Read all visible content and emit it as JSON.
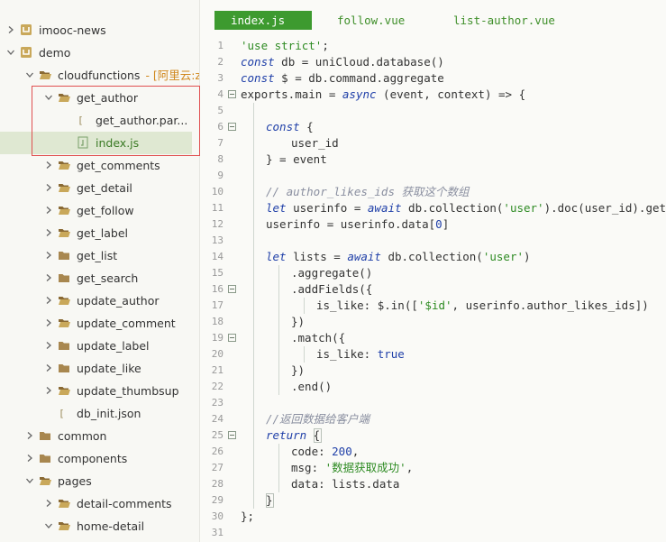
{
  "sidebar": {
    "items": [
      {
        "label": "imooc-news",
        "icon": "project-icon",
        "depth": 0,
        "arrow": "right"
      },
      {
        "label": "demo",
        "icon": "project-icon",
        "depth": 0,
        "arrow": "down"
      },
      {
        "label": "cloudfunctions",
        "suffix": "- [阿里云:zl",
        "icon": "folder-open-icon",
        "depth": 1,
        "arrow": "down"
      },
      {
        "label": "get_author",
        "icon": "folder-open-icon",
        "depth": 2,
        "arrow": "down"
      },
      {
        "label": "get_author.par...",
        "icon": "json-file-icon",
        "depth": 3,
        "arrow": "none"
      },
      {
        "label": "index.js",
        "icon": "js-file-icon",
        "depth": 3,
        "arrow": "none",
        "selected": true
      },
      {
        "label": "get_comments",
        "icon": "folder-open-icon",
        "depth": 2,
        "arrow": "right"
      },
      {
        "label": "get_detail",
        "icon": "folder-open-icon",
        "depth": 2,
        "arrow": "right"
      },
      {
        "label": "get_follow",
        "icon": "folder-open-icon",
        "depth": 2,
        "arrow": "right"
      },
      {
        "label": "get_label",
        "icon": "folder-open-icon",
        "depth": 2,
        "arrow": "right"
      },
      {
        "label": "get_list",
        "icon": "folder-icon",
        "depth": 2,
        "arrow": "right"
      },
      {
        "label": "get_search",
        "icon": "folder-icon",
        "depth": 2,
        "arrow": "right"
      },
      {
        "label": "update_author",
        "icon": "folder-open-icon",
        "depth": 2,
        "arrow": "right"
      },
      {
        "label": "update_comment",
        "icon": "folder-open-icon",
        "depth": 2,
        "arrow": "right"
      },
      {
        "label": "update_label",
        "icon": "folder-icon",
        "depth": 2,
        "arrow": "right"
      },
      {
        "label": "update_like",
        "icon": "folder-icon",
        "depth": 2,
        "arrow": "right"
      },
      {
        "label": "update_thumbsup",
        "icon": "folder-open-icon",
        "depth": 2,
        "arrow": "right"
      },
      {
        "label": "db_init.json",
        "icon": "json-file-icon",
        "depth": 2,
        "arrow": "none"
      },
      {
        "label": "common",
        "icon": "folder-icon",
        "depth": 1,
        "arrow": "right"
      },
      {
        "label": "components",
        "icon": "folder-icon",
        "depth": 1,
        "arrow": "right"
      },
      {
        "label": "pages",
        "icon": "folder-open-icon",
        "depth": 1,
        "arrow": "down"
      },
      {
        "label": "detail-comments",
        "icon": "folder-open-icon",
        "depth": 2,
        "arrow": "right"
      },
      {
        "label": "home-detail",
        "icon": "folder-open-icon",
        "depth": 2,
        "arrow": "down"
      }
    ]
  },
  "tabs": [
    {
      "label": "index.js",
      "active": true
    },
    {
      "label": "follow.vue",
      "active": false
    },
    {
      "label": "list-author.vue",
      "active": false
    }
  ],
  "code": {
    "lines": [
      {
        "n": "1",
        "indent": 0,
        "tokens": [
          [
            "str",
            "'use strict'"
          ],
          [
            "plain",
            ";"
          ]
        ]
      },
      {
        "n": "2",
        "indent": 0,
        "tokens": [
          [
            "kw",
            "const"
          ],
          [
            "plain",
            " db = uniCloud.database()"
          ]
        ]
      },
      {
        "n": "3",
        "indent": 0,
        "tokens": [
          [
            "kw",
            "const"
          ],
          [
            "plain",
            " $ = db.command.aggregate"
          ]
        ]
      },
      {
        "n": "4",
        "indent": 0,
        "fold": true,
        "tokens": [
          [
            "plain",
            "exports.main = "
          ],
          [
            "kw",
            "async"
          ],
          [
            "plain",
            " (event, context) => {"
          ]
        ]
      },
      {
        "n": "5",
        "indent": 0,
        "tokens": []
      },
      {
        "n": "6",
        "indent": 1,
        "fold": true,
        "tokens": [
          [
            "kw",
            "const"
          ],
          [
            "plain",
            " {"
          ]
        ]
      },
      {
        "n": "7",
        "indent": 2,
        "tokens": [
          [
            "plain",
            "user_id"
          ]
        ]
      },
      {
        "n": "8",
        "indent": 1,
        "tokens": [
          [
            "plain",
            "} = event"
          ]
        ]
      },
      {
        "n": "9",
        "indent": 0,
        "tokens": []
      },
      {
        "n": "10",
        "indent": 1,
        "tokens": [
          [
            "com",
            "// author_likes_ids 获取这个数组"
          ]
        ]
      },
      {
        "n": "11",
        "indent": 1,
        "tokens": [
          [
            "kw",
            "let"
          ],
          [
            "plain",
            " userinfo = "
          ],
          [
            "kw",
            "await"
          ],
          [
            "plain",
            " db.collection("
          ],
          [
            "str",
            "'user'"
          ],
          [
            "plain",
            ").doc(user_id).get()"
          ]
        ]
      },
      {
        "n": "12",
        "indent": 1,
        "tokens": [
          [
            "plain",
            "userinfo = userinfo.data["
          ],
          [
            "num",
            "0"
          ],
          [
            "plain",
            "]"
          ]
        ]
      },
      {
        "n": "13",
        "indent": 0,
        "tokens": []
      },
      {
        "n": "14",
        "indent": 1,
        "tokens": [
          [
            "kw",
            "let"
          ],
          [
            "plain",
            " lists = "
          ],
          [
            "kw",
            "await"
          ],
          [
            "plain",
            " db.collection("
          ],
          [
            "str",
            "'user'"
          ],
          [
            "plain",
            ")"
          ]
        ]
      },
      {
        "n": "15",
        "indent": 2,
        "tokens": [
          [
            "plain",
            ".aggregate()"
          ]
        ]
      },
      {
        "n": "16",
        "indent": 2,
        "fold": true,
        "tokens": [
          [
            "plain",
            ".addFields({"
          ]
        ]
      },
      {
        "n": "17",
        "indent": 3,
        "tokens": [
          [
            "plain",
            "is_like: $.in(["
          ],
          [
            "str",
            "'$id'"
          ],
          [
            "plain",
            ", userinfo.author_likes_ids])"
          ]
        ]
      },
      {
        "n": "18",
        "indent": 2,
        "tokens": [
          [
            "plain",
            "})"
          ]
        ]
      },
      {
        "n": "19",
        "indent": 2,
        "fold": true,
        "tokens": [
          [
            "plain",
            ".match({"
          ]
        ]
      },
      {
        "n": "20",
        "indent": 3,
        "tokens": [
          [
            "plain",
            "is_like: "
          ],
          [
            "bool",
            "true"
          ]
        ]
      },
      {
        "n": "21",
        "indent": 2,
        "tokens": [
          [
            "plain",
            "})"
          ]
        ]
      },
      {
        "n": "22",
        "indent": 2,
        "tokens": [
          [
            "plain",
            ".end()"
          ]
        ]
      },
      {
        "n": "23",
        "indent": 0,
        "tokens": []
      },
      {
        "n": "24",
        "indent": 1,
        "tokens": [
          [
            "com",
            "//返回数据给客户端"
          ]
        ]
      },
      {
        "n": "25",
        "indent": 1,
        "fold": true,
        "tokens": [
          [
            "kw",
            "return"
          ],
          [
            "plain",
            " {"
          ]
        ]
      },
      {
        "n": "26",
        "indent": 2,
        "tokens": [
          [
            "plain",
            "code: "
          ],
          [
            "num",
            "200"
          ],
          [
            "plain",
            ","
          ]
        ]
      },
      {
        "n": "27",
        "indent": 2,
        "tokens": [
          [
            "plain",
            "msg: "
          ],
          [
            "str",
            "'数据获取成功'"
          ],
          [
            "plain",
            ","
          ]
        ]
      },
      {
        "n": "28",
        "indent": 2,
        "tokens": [
          [
            "plain",
            "data: lists.data"
          ]
        ]
      },
      {
        "n": "29",
        "indent": 1,
        "tokens": [
          [
            "plain",
            "}"
          ]
        ]
      },
      {
        "n": "30",
        "indent": 0,
        "tokens": [
          [
            "plain",
            "};"
          ]
        ]
      },
      {
        "n": "31",
        "indent": 0,
        "tokens": []
      }
    ]
  },
  "colors": {
    "tab_active_bg": "#3d9a2f",
    "keyword": "#1f3fa8",
    "string": "#2e8b23",
    "comment": "#8a8fa0",
    "selection_box": "#e05050",
    "selected_row_bg": "#dfe8d2"
  }
}
